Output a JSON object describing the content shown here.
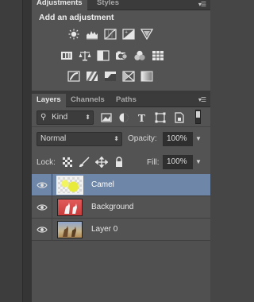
{
  "adjustments_panel": {
    "tabs": [
      "Adjustments",
      "Styles"
    ],
    "title": "Add an adjustment",
    "row1_icons": [
      "brightness-contrast-icon",
      "levels-icon",
      "curves-icon",
      "exposure-icon",
      "vibrance-icon"
    ],
    "row2_icons": [
      "hue-saturation-icon",
      "color-balance-icon",
      "black-white-icon",
      "photo-filter-icon",
      "channel-mixer-icon",
      "color-lookup-icon"
    ],
    "row3_icons": [
      "invert-icon",
      "posterize-icon",
      "threshold-icon",
      "gradient-map-icon",
      "selective-color-icon"
    ]
  },
  "layers_panel": {
    "tabs": [
      "Layers",
      "Channels",
      "Paths"
    ],
    "filter": {
      "value": "Kind"
    },
    "blend_mode": {
      "value": "Normal"
    },
    "opacity": {
      "label": "Opacity:",
      "value": "100%"
    },
    "lock": {
      "label": "Lock:"
    },
    "fill": {
      "label": "Fill:",
      "value": "100%"
    },
    "layers": [
      {
        "name": "Camel",
        "selected": true,
        "thumb_color": "#e4e84a"
      },
      {
        "name": "Background",
        "selected": false,
        "thumb_color": "#d94848"
      },
      {
        "name": "Layer 0",
        "selected": false,
        "thumb_color": "#7a8fb5"
      }
    ]
  },
  "colors": {
    "panel_bg": "#535353",
    "selected_row": "#6e87a8",
    "dark_bar": "#3b3b3b"
  }
}
